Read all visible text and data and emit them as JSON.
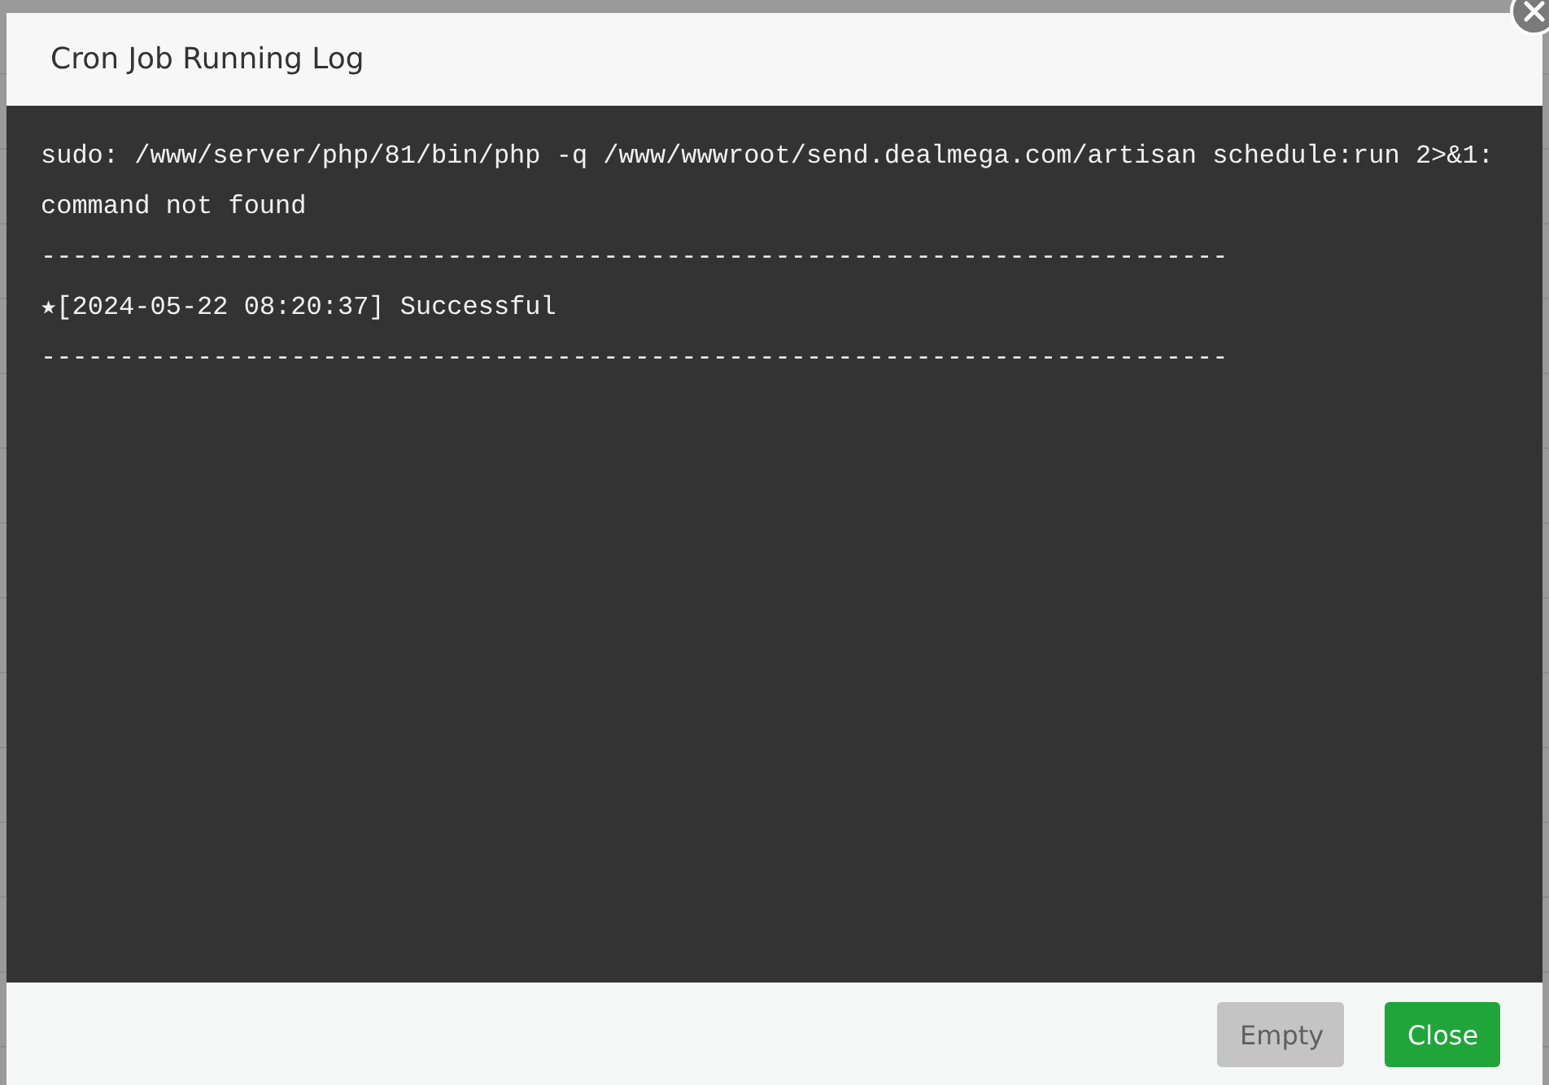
{
  "dialog": {
    "title": "Cron Job Running Log",
    "log_lines": [
      "sudo: /www/server/php/81/bin/php -q /www/wwwroot/send.dealmega.com/artisan schedule:run 2>&1: command not found",
      "----------------------------------------------------------------------------",
      "★[2024-05-22 08:20:37] Successful",
      "----------------------------------------------------------------------------"
    ],
    "buttons": [
      {
        "label": "Empty",
        "kind": "secondary",
        "disabled": true
      },
      {
        "label": "Close",
        "kind": "primary",
        "disabled": false
      }
    ]
  }
}
